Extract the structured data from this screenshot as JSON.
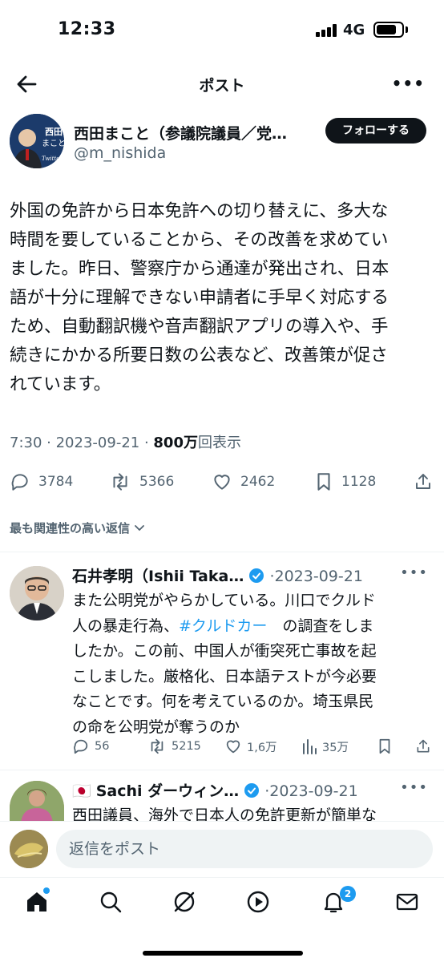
{
  "status_bar": {
    "time": "12:33",
    "network": "4G"
  },
  "header": {
    "title": "ポスト",
    "more": "•••"
  },
  "post": {
    "author_name": "西田まこと（参議院議員／党…",
    "author_handle": "@m_nishida",
    "avatar_text": "西田まこと",
    "avatar_sub": "Twitter",
    "follow_label": "フォローする",
    "text": "外国の免許から日本免許への切り替えに、多大な\n時間を要していることから、その改善を求めてい\nました。昨日、警察庁から通達が発出され、日本\n語が十分に理解できない申請者に手早く対応する\nため、自動翻訳機や音声翻訳アプリの導入や、手\n続きにかかる所要日数の公表など、改善策が促さ\nれています。",
    "time": "7:30",
    "date": "2023-09-21",
    "views_count": "800万",
    "views_label": "回表示",
    "replies": "3784",
    "reposts": "5366",
    "likes": "2462",
    "bookmarks": "1128"
  },
  "sort_label": "最も関連性の高い返信",
  "replies": [
    {
      "name": "石井孝明（Ishii Taka…",
      "date": "2023-09-21",
      "text_before": "また公明党がやらかしている。川口でクルド\n人の暴走行為、",
      "hashtag": "#クルドカー",
      "text_after": "　の調査をしま\nしたか。この前、中国人が衝突死亡事故を起\nこしました。厳格化、日本語テストが今必要\nなことです。何を考えているのか。埼玉県民\nの命を公明党が奪うのか",
      "replies": "56",
      "reposts": "5215",
      "likes": "1,6万",
      "views": "35万"
    },
    {
      "flag": "🇯🇵",
      "name": "Sachi ダーウィン…",
      "date": "2023-09-21",
      "text": "西田議員、海外で日本人の免許更新が簡単な"
    }
  ],
  "composer": {
    "placeholder": "返信をポスト"
  },
  "tabbar": {
    "notifications_badge": "2"
  },
  "colors": {
    "accent": "#1d9bf0",
    "text": "#0f1419",
    "muted": "#536471"
  }
}
